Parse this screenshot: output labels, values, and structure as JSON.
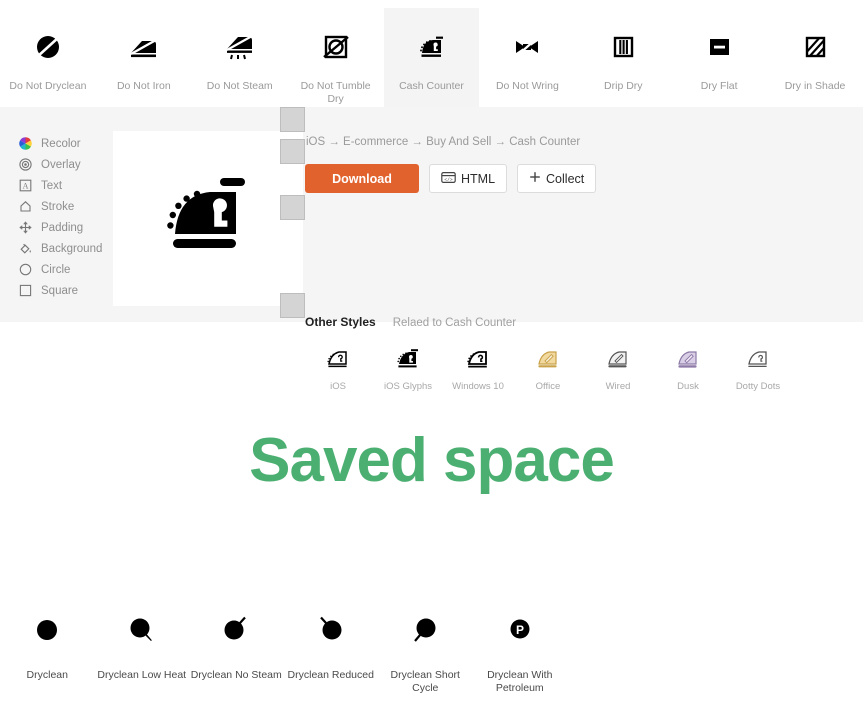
{
  "tabs": [
    {
      "label": "Do Not Dryclean",
      "icon": "do-not-dryclean-icon",
      "selected": false
    },
    {
      "label": "Do Not Iron",
      "icon": "do-not-iron-icon",
      "selected": false
    },
    {
      "label": "Do Not Steam",
      "icon": "do-not-steam-icon",
      "selected": false
    },
    {
      "label": "Do Not Tumble Dry",
      "icon": "do-not-tumble-dry-icon",
      "selected": false
    },
    {
      "label": "Cash Counter",
      "icon": "cash-counter-icon",
      "selected": true
    },
    {
      "label": "Do Not Wring",
      "icon": "do-not-wring-icon",
      "selected": false
    },
    {
      "label": "Drip Dry",
      "icon": "drip-dry-icon",
      "selected": false
    },
    {
      "label": "Dry Flat",
      "icon": "dry-flat-icon",
      "selected": false
    },
    {
      "label": "Dry in Shade",
      "icon": "dry-in-shade-icon",
      "selected": false
    }
  ],
  "sidebar": {
    "items": [
      {
        "label": "Recolor",
        "icon": "color-wheel-icon"
      },
      {
        "label": "Overlay",
        "icon": "target-overlay-icon"
      },
      {
        "label": "Text",
        "icon": "text-box-icon"
      },
      {
        "label": "Stroke",
        "icon": "stroke-shape-icon"
      },
      {
        "label": "Padding",
        "icon": "move-arrows-icon"
      },
      {
        "label": "Background",
        "icon": "paint-bucket-icon"
      },
      {
        "label": "Circle",
        "icon": "circle-outline-icon"
      },
      {
        "label": "Square",
        "icon": "square-outline-icon"
      }
    ]
  },
  "preview": {
    "icon": "cash-counter-glyph",
    "alt": "Cash Counter"
  },
  "breadcrumb": {
    "text": "iOS → E-commerce → Buy And Sell → Cash Counter"
  },
  "actions": {
    "download_label": "Download",
    "html_label": "HTML",
    "html_icon": "code-window-icon",
    "collect_label": "Collect",
    "collect_icon": "plus-icon"
  },
  "other_styles": {
    "title": "Other Styles",
    "subtitle": "Relaed to Cash Counter",
    "cards": [
      {
        "name": "iOS",
        "icon": "style-ios-icon"
      },
      {
        "name": "iOS Glyphs",
        "icon": "style-ios-glyphs-icon"
      },
      {
        "name": "Windows 10",
        "icon": "style-windows10-icon"
      },
      {
        "name": "Office",
        "icon": "style-office-icon"
      },
      {
        "name": "Wired",
        "icon": "style-wired-icon"
      },
      {
        "name": "Dusk",
        "icon": "style-dusk-icon"
      },
      {
        "name": "Dotty Dots",
        "icon": "style-dotty-dots-icon"
      },
      {
        "name": "",
        "icon": "style-empty-icon"
      }
    ]
  },
  "banner": {
    "text": "Saved space",
    "color": "#4caf72"
  },
  "bottom_icons": [
    {
      "label": "Dryclean",
      "icon": "dryclean-icon",
      "variant": "plain"
    },
    {
      "label": "Dryclean Low Heat",
      "icon": "dryclean-low-heat-icon",
      "variant": "low-heat"
    },
    {
      "label": "Dryclean No Steam",
      "icon": "dryclean-no-steam-icon",
      "variant": "no-steam"
    },
    {
      "label": "Dryclean Reduced",
      "icon": "dryclean-reduced-icon",
      "variant": "reduced"
    },
    {
      "label": "Dryclean Short Cycle",
      "icon": "dryclean-short-cycle-icon",
      "variant": "short-cycle"
    },
    {
      "label": "Dryclean With Petroleum",
      "icon": "dryclean-petroleum-icon",
      "variant": "petroleum"
    }
  ],
  "colors": {
    "accent": "#e2622e",
    "panel_bg": "#f5f5f5",
    "selected_tab_bg": "#f4f4f4",
    "banner_green": "#4caf72",
    "muted_text": "#9a9a9a"
  }
}
